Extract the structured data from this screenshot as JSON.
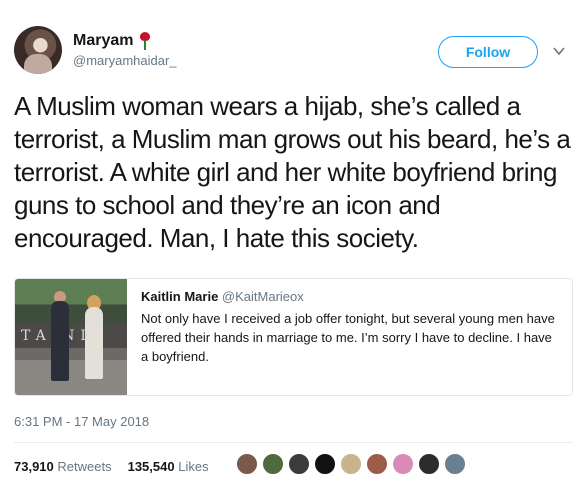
{
  "author": {
    "name": "Maryam",
    "handle": "@maryamhaidar_"
  },
  "follow_label": "Follow",
  "tweet_text": "A Muslim woman wears a hijab, she’s called a terrorist, a Muslim man grows out his beard, he’s a terrorist. A white girl and her white boyfriend bring guns to school and they’re an icon and encouraged. Man, I hate this society.",
  "quoted_tweet": {
    "name": "Kaitlin Marie",
    "handle": "@KaitMarieox",
    "text": "Not only have I received a job offer tonight, but several young men have offered their hands in marriage to me. I’m sorry I have to decline. I have a boyfriend.",
    "photo_wall_text": "TA NI"
  },
  "timestamp": "6:31 PM - 17 May 2018",
  "stats": {
    "retweets_count": "73,910",
    "retweets_label": "Retweets",
    "likes_count": "135,540",
    "likes_label": "Likes"
  },
  "liker_colors": [
    "#7a5a4a",
    "#4f6b3d",
    "#3b3b3b",
    "#111111",
    "#c8b48a",
    "#9b5c4a",
    "#d98bb8",
    "#2c2c2c",
    "#6a7f8f"
  ],
  "colors": {
    "accent": "#1da1f2",
    "secondary_text": "#657786",
    "rose": "#c8102e"
  }
}
